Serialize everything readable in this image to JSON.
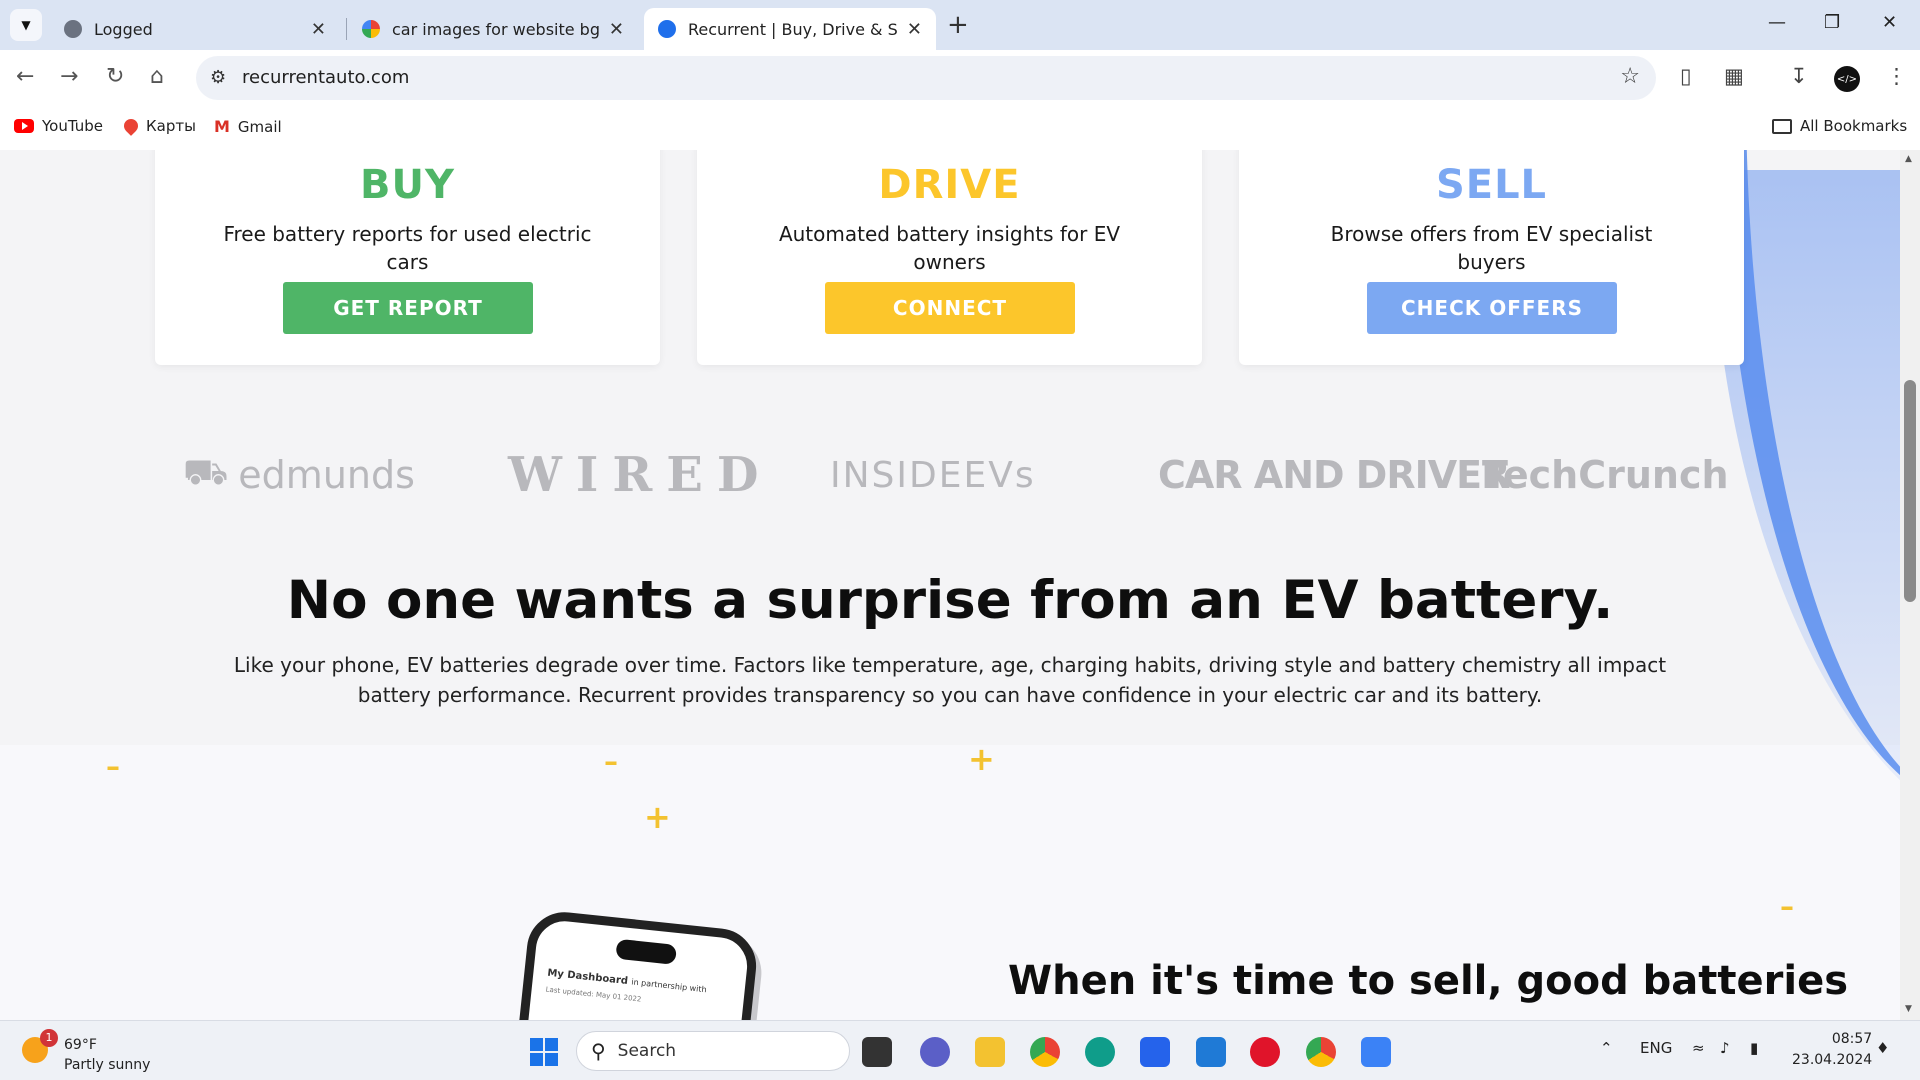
{
  "browser": {
    "tabs": [
      {
        "title": "Logged",
        "active": false
      },
      {
        "title": "car images for website bg non",
        "active": false
      },
      {
        "title": "Recurrent | Buy, Drive & Sell El",
        "active": true
      }
    ],
    "url": "recurrentauto.com",
    "bookmarks": [
      "YouTube",
      "Карты",
      "Gmail"
    ],
    "all_bookmarks": "All Bookmarks"
  },
  "cards": [
    {
      "heading": "BUY",
      "description": "Free battery reports for used electric cars",
      "button": "GET REPORT",
      "color": "#4fb567"
    },
    {
      "heading": "DRIVE",
      "description": "Automated battery insights for EV owners",
      "button": "CONNECT",
      "color": "#fcc62b"
    },
    {
      "heading": "SELL",
      "description": "Browse offers from EV specialist buyers",
      "button": "CHECK OFFERS",
      "color": "#7ca8f2"
    }
  ],
  "press": [
    "edmunds",
    "WIRED",
    "INSIDEEVs",
    "CAR AND DRIVER",
    "TechCrunch"
  ],
  "hero": {
    "heading": "No one wants a surprise from an EV battery.",
    "text": "Like your phone, EV batteries degrade over time. Factors like temperature, age, charging habits, driving style and battery chemistry all impact battery performance. Recurrent provides transparency so you can have confidence in your electric car and its battery."
  },
  "phone": {
    "title": "My Dashboard",
    "partner": "in partnership with",
    "updated": "Last updated: May 01 2022"
  },
  "sell_heading": "When it's time to sell, good batteries",
  "taskbar": {
    "weather_temp": "69°F",
    "weather_desc": "Partly sunny",
    "weather_badge": "1",
    "search": "Search",
    "lang": "ENG",
    "time": "08:57",
    "date": "23.04.2024"
  }
}
